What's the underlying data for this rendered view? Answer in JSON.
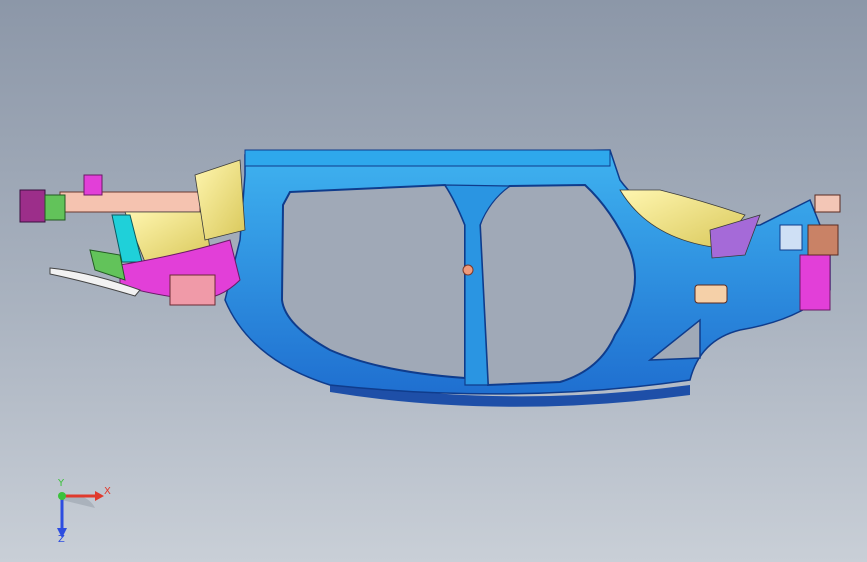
{
  "viewport": {
    "background_top": "#8c97a8",
    "background_bottom": "#c9cfd7"
  },
  "model": {
    "description_icon": "car-body-side-frame-3d-model",
    "main_color": "#2e9be6",
    "accent_colors": [
      "#e23fd8",
      "#f2f28a",
      "#f5c3b0",
      "#62c35a",
      "#1fd0d9"
    ]
  },
  "triad": {
    "x_label": "X",
    "y_label": "Y",
    "z_label": "Z",
    "x_color": "#e03a2d",
    "y_color": "#3cc13c",
    "z_color": "#2d4de0"
  }
}
